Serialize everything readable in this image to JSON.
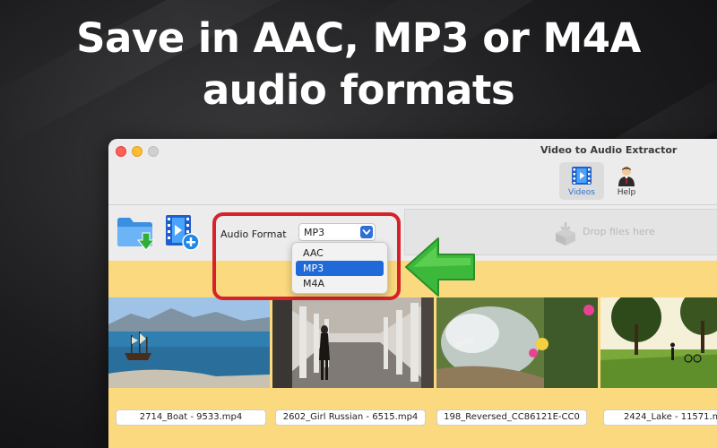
{
  "headline": {
    "line1": "Save in AAC, MP3 or M4A",
    "line2": "audio formats"
  },
  "window": {
    "title": "Video to Audio Extractor",
    "toolbar": [
      {
        "label": "Videos",
        "icon": "film-icon",
        "selected": true
      },
      {
        "label": "Help",
        "icon": "help-person-icon",
        "selected": false
      }
    ]
  },
  "controls": {
    "format_label": "Audio Format",
    "format_value": "MP3",
    "options": [
      "AAC",
      "MP3",
      "M4A"
    ],
    "selected_option": "MP3",
    "drop_text": "Drop files here"
  },
  "files": [
    {
      "name": "2714_Boat - 9533.mp4"
    },
    {
      "name": "2602_Girl Russian - 6515.mp4"
    },
    {
      "name": "198_Reversed_CC86121E-CC0"
    },
    {
      "name": "2424_Lake - 11571.m"
    }
  ],
  "colors": {
    "accent": "#1f6ad8",
    "highlight_border": "#d6232a",
    "arrow": "#3cb93a",
    "strip": "#fbd97f"
  }
}
